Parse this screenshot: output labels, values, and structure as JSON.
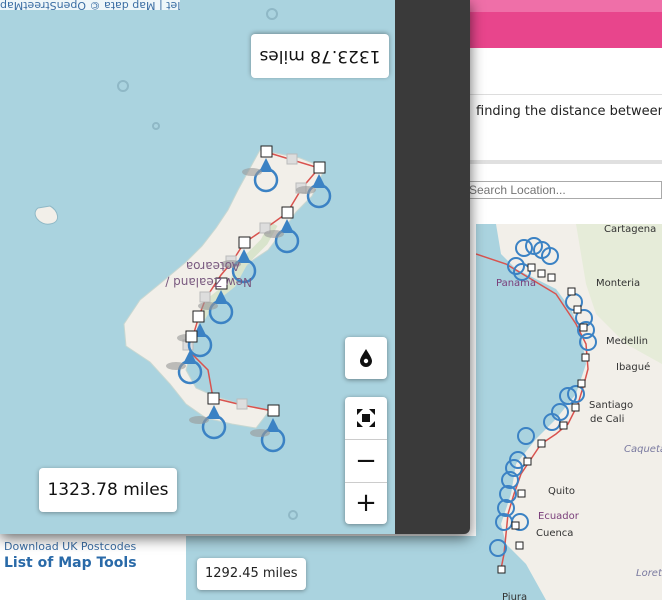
{
  "background_page": {
    "description_snippet": "finding the distance between t",
    "search_placeholder": "Search Location...",
    "links": [
      "Download UK Postcodes",
      "List of Map Tools",
      ""
    ],
    "distance_label": "1292.45 miles",
    "map_labels": [
      {
        "id": "cartagena",
        "text": "Cartagena"
      },
      {
        "id": "panama",
        "text": "Panama"
      },
      {
        "id": "monteria",
        "text": "Monteria"
      },
      {
        "id": "medellin",
        "text": "Medellin"
      },
      {
        "id": "ibague",
        "text": "Ibagué"
      },
      {
        "id": "santiago",
        "text": "Santiago"
      },
      {
        "id": "de-cali",
        "text": "de Cali"
      },
      {
        "id": "quito",
        "text": "Quito"
      },
      {
        "id": "ecuador",
        "text": "Ecuador"
      },
      {
        "id": "cuenca",
        "text": "Cuenca"
      },
      {
        "id": "caqueta",
        "text": "Caquetá"
      },
      {
        "id": "loreto",
        "text": "Loreto"
      },
      {
        "id": "piura",
        "text": "Piura"
      }
    ]
  },
  "main_window": {
    "attribution": "Leaflet | Map data © OpenStreetMap",
    "distance_top_flipped": "1323.78 miles",
    "distance_bottom": "1323.78 miles",
    "map_label_flipped": [
      "New Zealand /",
      "Aotearoa"
    ],
    "controls": {
      "drop_icon": "droplet-icon",
      "fullscreen_icon": "fullscreen-icon",
      "zoom_out": "−",
      "zoom_in": "+"
    }
  },
  "colors": {
    "map_water": "#aad3df",
    "land": "#f2efe9",
    "route_line": "#d9534f",
    "marker": "#3b82c4",
    "pink_header": "#e8458c"
  }
}
